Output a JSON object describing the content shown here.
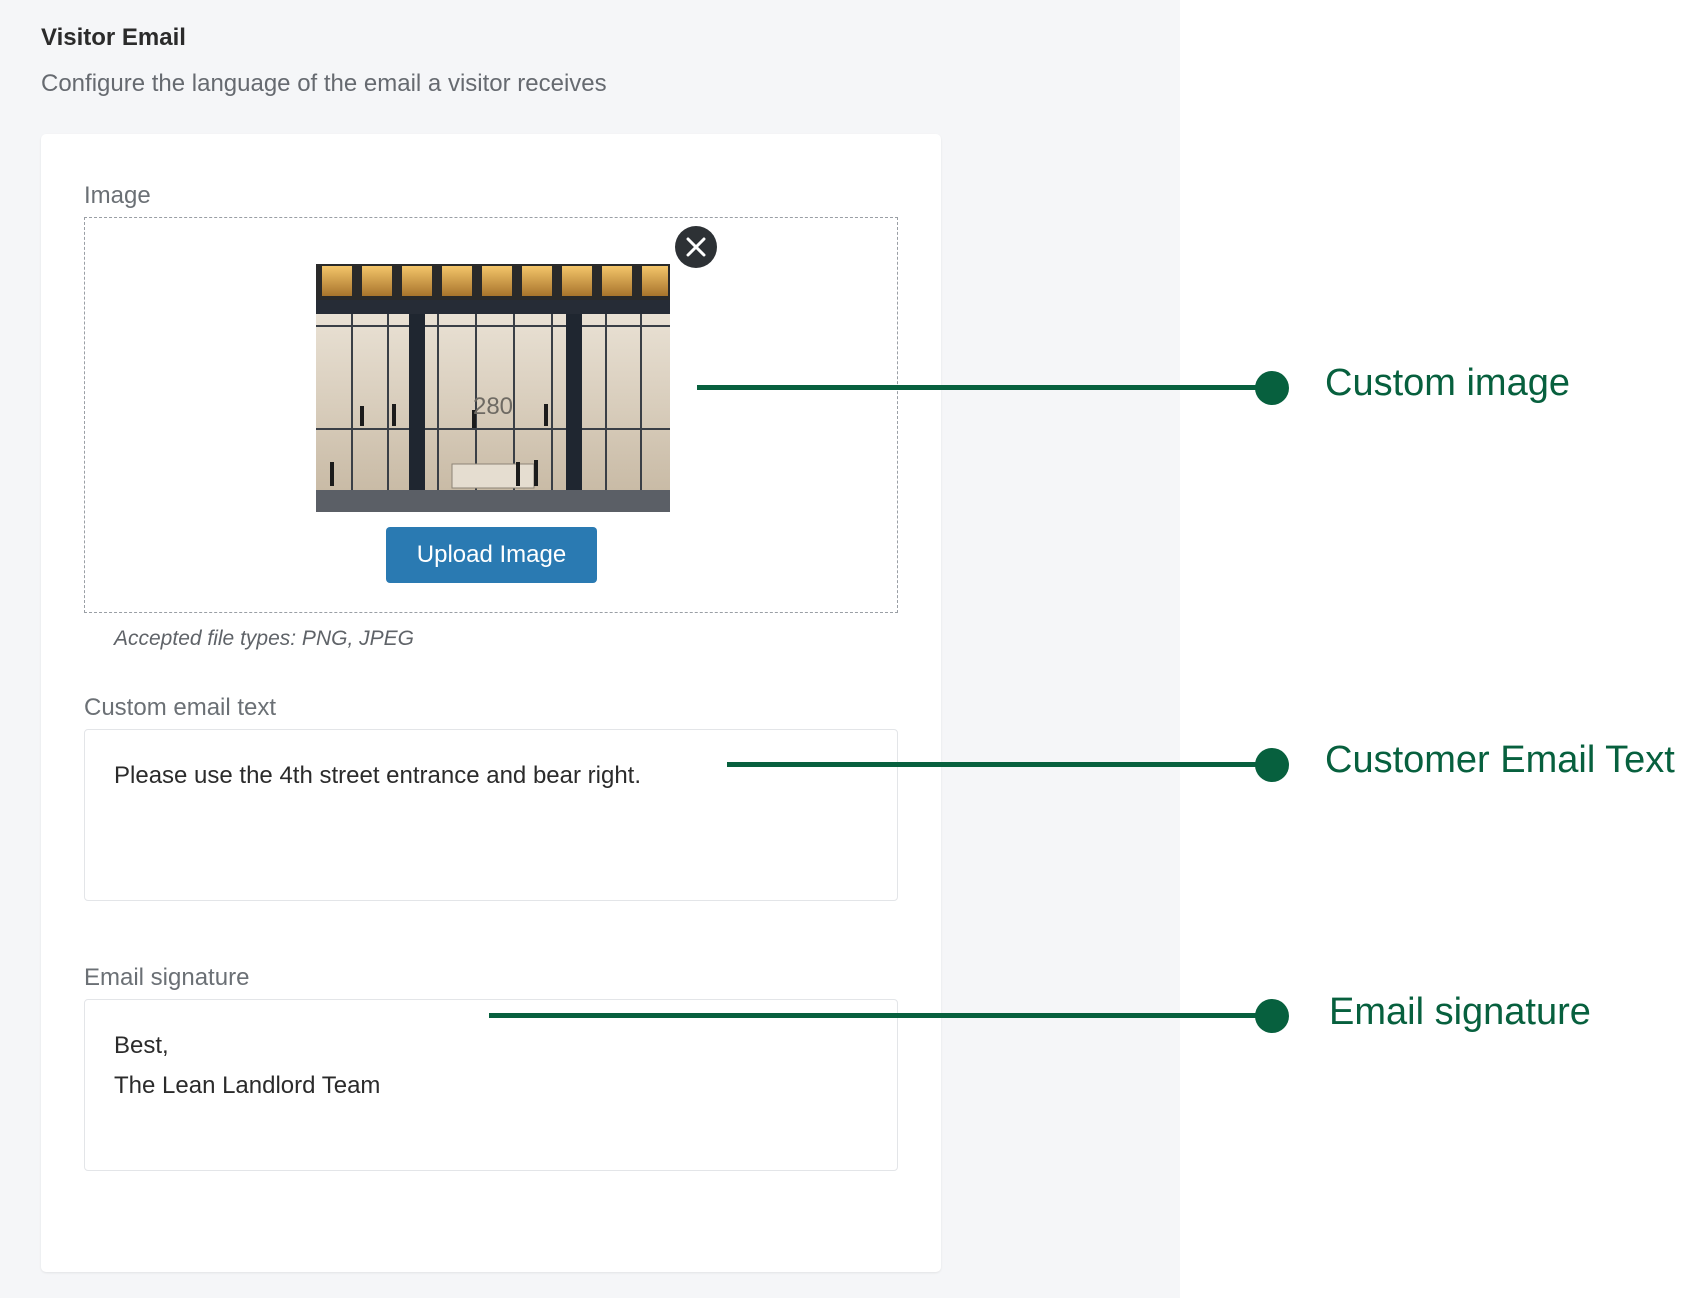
{
  "section": {
    "title": "Visitor Email",
    "description": "Configure the language of the email a visitor receives"
  },
  "image_field": {
    "label": "Image",
    "preview_caption": "280",
    "upload_label": "Upload Image",
    "helper_text": "Accepted file types: PNG, JPEG"
  },
  "email_text_field": {
    "label": "Custom email text",
    "value": "Please use the 4th street entrance and bear right."
  },
  "signature_field": {
    "label": "Email signature",
    "lines": [
      "Best,",
      "The Lean Landlord Team"
    ]
  },
  "annotations": [
    {
      "label": "Custom image"
    },
    {
      "label": "Customer Email Text"
    },
    {
      "label": "Email signature"
    }
  ],
  "colors": {
    "accent": "#07603e",
    "button": "#2a7ab2",
    "pane_background": "#f5f6f8"
  },
  "icons": {
    "remove": "close-icon"
  }
}
